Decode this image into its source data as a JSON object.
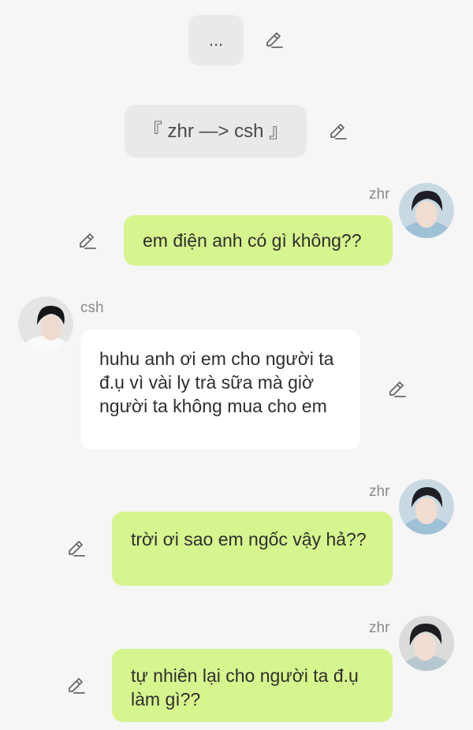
{
  "system_messages": [
    {
      "text": "..."
    },
    {
      "text": "『 zhr —> csh 』"
    }
  ],
  "messages": [
    {
      "sender": "zhr",
      "side": "right",
      "text": "em điện anh có gì không??"
    },
    {
      "sender": "csh",
      "side": "left",
      "text": "huhu anh ơi em cho người ta đ.ụ vì vài ly trà sữa mà giờ người ta không mua cho em"
    },
    {
      "sender": "zhr",
      "side": "right",
      "text": "trời ơi sao em ngốc vậy hả??"
    },
    {
      "sender": "zhr",
      "side": "right",
      "text": "tự nhiên lại cho người ta đ.ụ làm gì??"
    }
  ],
  "colors": {
    "outgoing_bubble": "#d7f58e",
    "incoming_bubble": "#ffffff",
    "system_bubble": "#e9e9e9",
    "background": "#f6f6f6"
  },
  "icons": {
    "edit": "pencil-icon"
  }
}
